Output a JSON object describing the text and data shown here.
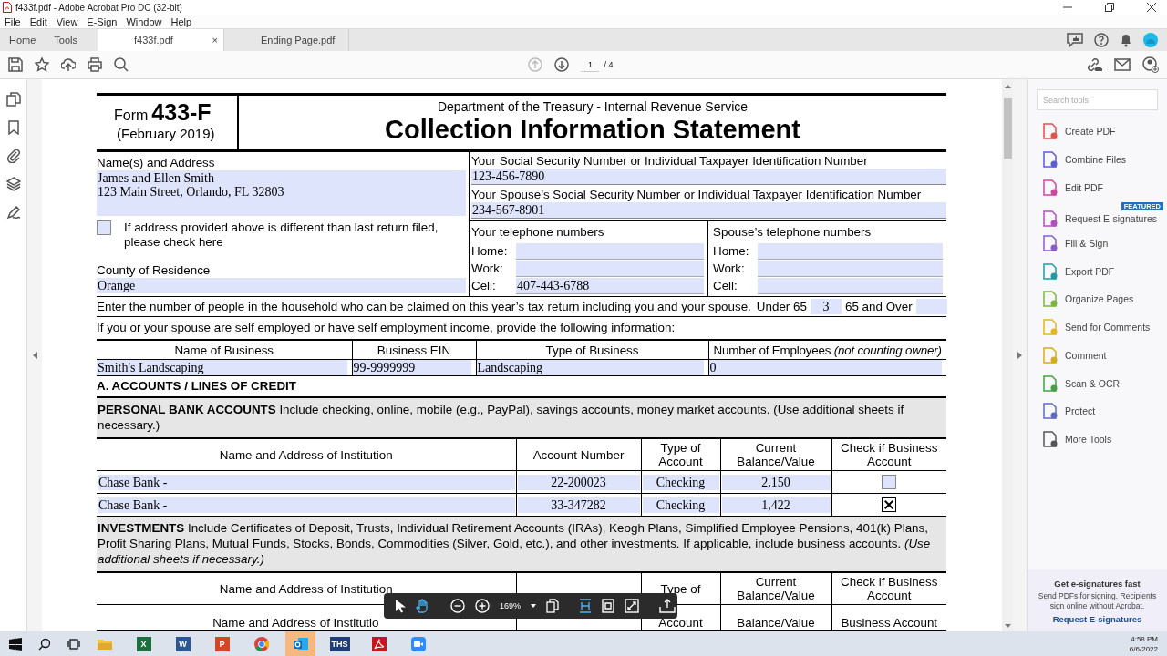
{
  "window": {
    "title": "f433f.pdf - Adobe Acrobat Pro DC (32-bit)"
  },
  "menu": [
    "File",
    "Edit",
    "View",
    "E-Sign",
    "Window",
    "Help"
  ],
  "tabs": [
    {
      "label": "Home",
      "kind": "nav",
      "selected": false
    },
    {
      "label": "Tools",
      "kind": "nav",
      "selected": false
    },
    {
      "label": "f433f.pdf",
      "kind": "doc",
      "selected": true,
      "close": "×"
    },
    {
      "label": "Ending Page.pdf",
      "kind": "doc",
      "selected": false
    }
  ],
  "page_nav": {
    "current": "1",
    "total": "/ 4"
  },
  "form": {
    "form_label": "Form",
    "form_number": "433-F",
    "form_date": "(February 2019)",
    "agency": "Department of the Treasury - Internal Revenue Service",
    "title": "Collection Information Statement",
    "name_address": {
      "label": "Name(s) and Address",
      "lines": [
        "James and Ellen Smith",
        "123 Main Street, Orlando, FL  32803"
      ]
    },
    "address_changed": {
      "checked": false,
      "label": "If address provided above is different than last return filed, please check here"
    },
    "county": {
      "label": "County of Residence",
      "value": "Orange"
    },
    "ssn": {
      "label": "Your Social Security Number or Individual Taxpayer Identification Number",
      "value": "123-456-7890"
    },
    "spouse_ssn": {
      "label": "Your Spouse’s Social Security Number or Individual Taxpayer Identification Number",
      "value": "234-567-8901"
    },
    "phones": [
      {
        "heading": "Your telephone numbers",
        "lines": [
          {
            "label": "Home:"
          },
          {
            "label": "Work:"
          },
          {
            "label": "Cell:",
            "value": "407-443-6788"
          }
        ]
      },
      {
        "heading": "Spouse’s telephone numbers",
        "lines": [
          {
            "label": "Home:"
          },
          {
            "label": "Work:"
          },
          {
            "label": "Cell:"
          }
        ]
      }
    ],
    "household": {
      "text": "Enter the number of people in the household who can be claimed on this year’s tax return including you and your spouse.",
      "under_label": "Under 65",
      "under_value": "3",
      "over_label": "65 and Over"
    },
    "self_employed_text": "If you or your spouse are self employed or have self employment income, provide the following information:",
    "business": {
      "columns": [
        "Name of Business",
        "Business EIN",
        "Type of Business",
        "Number of Employees *(not counting owner)*"
      ],
      "values": [
        "Smith's Landscaping",
        "99-9999999",
        "Landscaping",
        "0"
      ]
    },
    "section_a": "A. ACCOUNTS / LINES OF CREDIT",
    "bank_intro": "**PERSONAL BANK ACCOUNTS** Include checking, online, mobile (e.g., PayPal), savings accounts, money market accounts. (Use additional sheets if necessary.)",
    "bank": {
      "columns": [
        "Name and Address of Institution",
        "Account Number",
        "Type of Account",
        "Current Balance/Value",
        "Check if Business Account"
      ],
      "rows": [
        {
          "cells": [
            "Chase Bank -",
            "22-200023",
            "Checking",
            "2,150"
          ],
          "business": false
        },
        {
          "cells": [
            "Chase Bank -",
            "33-347282",
            "Checking",
            "1,422"
          ],
          "business": true
        }
      ]
    },
    "investments_intro": "**INVESTMENTS** Include Certificates of Deposit, Trusts, Individual Retirement Accounts (IRAs), Keogh Plans, Simplified Employee Pensions, 401(k) Plans, Profit Sharing Plans, Mutual Funds, Stocks, Bonds, Commodities (Silver, Gold, etc.), and other investments. If applicable, include business accounts. *(Use additional sheets if necessary.)*",
    "investment_header": {
      "name": "Name and Address of Institution",
      "type": "Type of",
      "balance": "Current Balance/Value",
      "business": "Check if Business Account"
    },
    "investment_header_repeat": {
      "name": "Name and Address of Institutio",
      "type": "Account",
      "balance": "Balance/Value",
      "business": "Business Account"
    }
  },
  "float_toolbar": {
    "zoom": "169%"
  },
  "tools_panel": {
    "search_placeholder": "Search tools",
    "items": [
      {
        "label": "Create PDF",
        "color": "#d9534f"
      },
      {
        "label": "Combine Files",
        "color": "#5b5bd6"
      },
      {
        "label": "Edit PDF",
        "color": "#c84b9e"
      },
      {
        "label": "Request E-signatures",
        "color": "#b04fc0",
        "badge": "FEATURED"
      },
      {
        "label": "Fill & Sign",
        "color": "#8b5cc7"
      },
      {
        "label": "Export PDF",
        "color": "#1f9aa0"
      },
      {
        "label": "Organize Pages",
        "color": "#7cb342"
      },
      {
        "label": "Send for Comments",
        "color": "#e0b820"
      },
      {
        "label": "Comment",
        "color": "#d4ad1f"
      },
      {
        "label": "Scan & OCR",
        "color": "#43a047"
      },
      {
        "label": "Protect",
        "color": "#5c6bc0"
      },
      {
        "label": "More Tools",
        "color": "#555555"
      }
    ],
    "promo": {
      "title": "Get e-signatures fast",
      "text": "Send PDFs for signing. Recipients sign online without Acrobat.",
      "link": "Request E-signatures"
    }
  },
  "taskbar": {
    "apps": [
      {
        "kind": "folder",
        "selected": false
      },
      {
        "kind": "excel",
        "glyph": "X",
        "selected": false
      },
      {
        "kind": "word",
        "glyph": "W",
        "selected": false
      },
      {
        "kind": "powerpoint",
        "glyph": "P",
        "selected": false
      },
      {
        "kind": "chrome",
        "selected": false
      },
      {
        "kind": "outlook",
        "selected": true
      },
      {
        "kind": "ths",
        "glyph": "THS",
        "selected": false
      },
      {
        "kind": "acrobat",
        "selected": false
      },
      {
        "kind": "zoom",
        "selected": false
      }
    ],
    "time": "4:58 PM",
    "date": "6/6/2022"
  }
}
